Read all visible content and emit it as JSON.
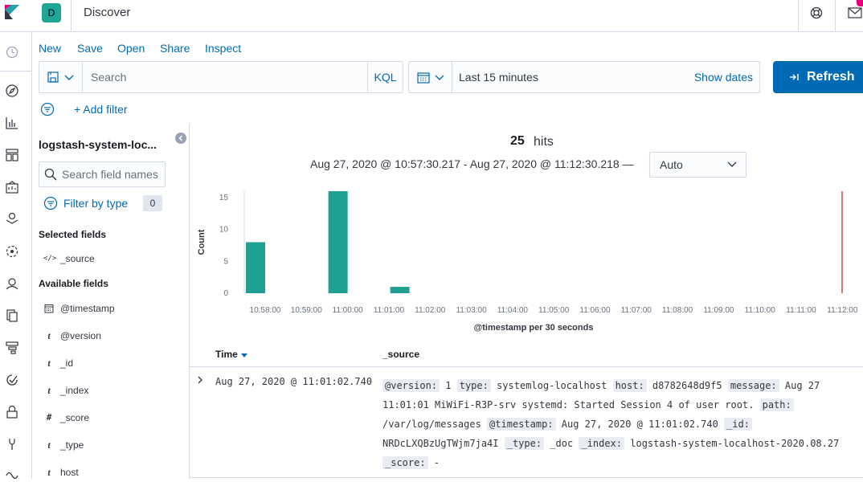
{
  "header": {
    "space_initial": "D",
    "app_title": "Discover"
  },
  "top_menu": {
    "new": "New",
    "save": "Save",
    "open": "Open",
    "share": "Share",
    "inspect": "Inspect"
  },
  "query_bar": {
    "search_placeholder": "Search",
    "language": "KQL",
    "date_range": "Last 15 minutes",
    "show_dates": "Show dates",
    "refresh": "Refresh",
    "add_filter": "+ Add filter"
  },
  "sidebar": {
    "index_pattern": "logstash-system-loc...",
    "field_search_placeholder": "Search field names",
    "filter_by_type": "Filter by type",
    "filter_count": "0",
    "selected_heading": "Selected fields",
    "selected_fields": [
      {
        "type": "</>",
        "name": "_source"
      }
    ],
    "available_heading": "Available fields",
    "available_fields": [
      {
        "type": "clock",
        "name": "@timestamp"
      },
      {
        "type": "t",
        "name": "@version"
      },
      {
        "type": "t",
        "name": "_id"
      },
      {
        "type": "t",
        "name": "_index"
      },
      {
        "type": "#",
        "name": "_score"
      },
      {
        "type": "t",
        "name": "_type"
      },
      {
        "type": "t",
        "name": "host"
      }
    ]
  },
  "results": {
    "hits_count": "25",
    "hits_label": "hits",
    "time_range": "Aug 27, 2020 @ 10:57:30.217 - Aug 27, 2020 @ 11:12:30.218 —",
    "interval": "Auto"
  },
  "chart_data": {
    "type": "bar",
    "xlabel": "@timestamp per 30 seconds",
    "ylabel": "Count",
    "ylim": [
      0,
      16
    ],
    "yticks": [
      0,
      5,
      10,
      15
    ],
    "x_ticks": [
      "10:58:00",
      "10:59:00",
      "11:00:00",
      "11:01:00",
      "11:02:00",
      "11:03:00",
      "11:04:00",
      "11:05:00",
      "11:06:00",
      "11:07:00",
      "11:08:00",
      "11:09:00",
      "11:10:00",
      "11:11:00",
      "11:12:00"
    ],
    "bars": [
      {
        "x": "10:58:00",
        "value": 8
      },
      {
        "x": "11:00:00",
        "value": 16
      },
      {
        "x": "11:01:30",
        "value": 1
      }
    ],
    "bar_color": "#20a093",
    "now_marker_color": "#bd271e"
  },
  "documents": {
    "columns": {
      "time": "Time",
      "source": "_source"
    },
    "rows": [
      {
        "time": "Aug 27, 2020 @ 11:01:02.740",
        "fields": [
          {
            "key": "@version:",
            "value": "1"
          },
          {
            "key": "type:",
            "value": "systemlog-localhost"
          },
          {
            "key": "host:",
            "value": "d8782648d9f5"
          },
          {
            "key": "message:",
            "value": "Aug 27 11:01:01 MiWiFi-R3P-srv systemd: Started Session 4 of user root."
          },
          {
            "key": "path:",
            "value": "/var/log/messages"
          },
          {
            "key": "@timestamp:",
            "value": "Aug 27, 2020 @ 11:01:02.740"
          },
          {
            "key": "_id:",
            "value": "NRDcLXQBzUgTWjm7ja4I"
          },
          {
            "key": "_type:",
            "value": "_doc"
          },
          {
            "key": "_index:",
            "value": "logstash-system-localhost-2020.08.27"
          },
          {
            "key": "_score:",
            "value": "-"
          }
        ]
      }
    ]
  }
}
